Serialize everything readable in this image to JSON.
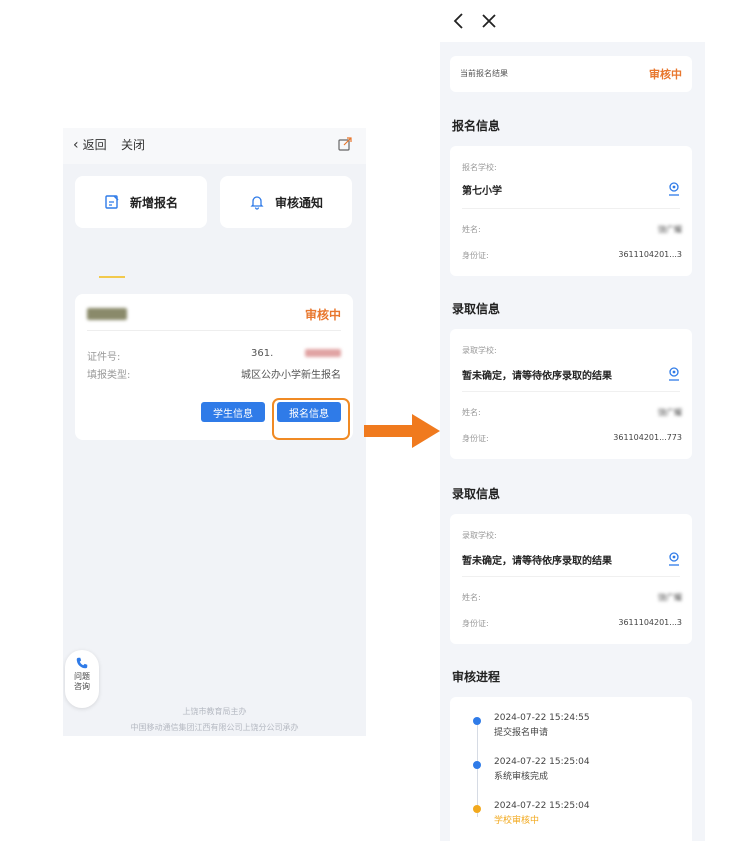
{
  "left_screen": {
    "back_label": "返回",
    "close_label": "关闭",
    "new_apply_label": "新增报名",
    "review_notice_label": "审核通知",
    "application": {
      "status": "审核中",
      "id_label": "证件号:",
      "id_value": "361.",
      "type_label": "填报类型:",
      "type_value": "城区公办小学新生报名",
      "student_info_button": "学生信息",
      "signup_info_button": "报名信息"
    },
    "consult_label": "问题咨询",
    "footer_line1": "上饶市教育局主办",
    "footer_line2": "中国移动通信集团江西有限公司上饶分公司承办"
  },
  "right_screen": {
    "current_result_label": "当前报名结果",
    "current_result_status": "审核中",
    "section_signup": "报名信息",
    "signup_school_label": "报名学校:",
    "signup_school_value": "第七小学",
    "name_label": "姓名:",
    "id_label": "身份证:",
    "signup_name_value": "饶广耀",
    "signup_id_value": "3611104201...3",
    "section_admission_1": "录取信息",
    "admission_school_label_1": "录取学校:",
    "admission_value_1": "暂未确定，请等待依序录取的结果",
    "admission_name_value_1": "饶广耀",
    "admission_id_value_1": "361104201...773",
    "section_admission_2": "录取信息",
    "admission_school_label_2": "录取学校:",
    "admission_value_2": "暂未确定，请等待依序录取的结果",
    "admission_name_value_2": "饶广耀",
    "admission_id_value_2": "3611104201...3",
    "section_progress": "审核进程",
    "progress": [
      {
        "time": "2024-07-22 15:24:55",
        "text": "提交报名申请",
        "color": "#2f7be8"
      },
      {
        "time": "2024-07-22 15:25:04",
        "text": "系统审核完成",
        "color": "#2f7be8"
      },
      {
        "time": "2024-07-22 15:25:04",
        "text": "学校审核中",
        "color": "#f2a91e"
      }
    ]
  },
  "colors": {
    "accent_blue": "#2f7be8",
    "status_orange": "#e8772e",
    "highlight_orange": "#f08a24"
  }
}
